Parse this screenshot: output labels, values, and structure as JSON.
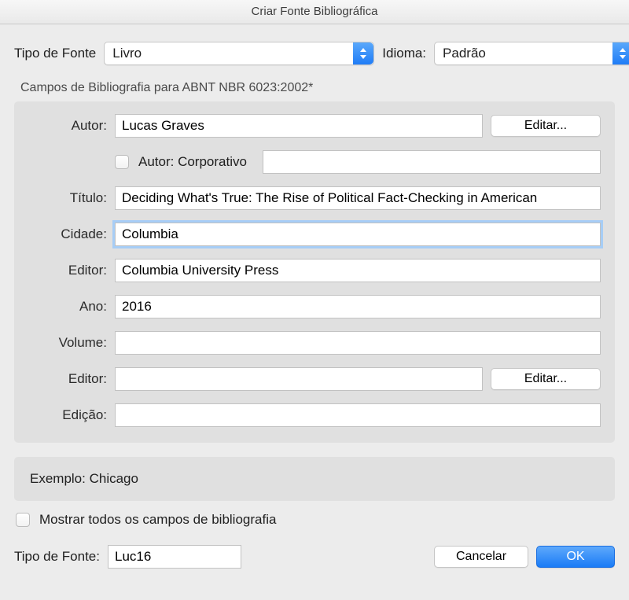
{
  "window": {
    "title": "Criar Fonte Bibliográfica"
  },
  "top": {
    "type_label": "Tipo de Fonte",
    "type_value": "Livro",
    "lang_label": "Idioma:",
    "lang_value": "Padrão"
  },
  "section_label": "Campos de Bibliografia para ABNT NBR 6023:2002*",
  "fields": {
    "author_label": "Autor:",
    "author_value": "Lucas Graves",
    "edit_button": "Editar...",
    "author_corp_label": "Autor: Corporativo",
    "author_corp_value": "",
    "title_label": "Título:",
    "title_value": "Deciding What's True: The Rise of Political Fact-Checking in American",
    "city_label": "Cidade:",
    "city_value": "Columbia",
    "publisher_label": "Editor:",
    "publisher_value": "Columbia University Press",
    "year_label": "Ano:",
    "year_value": "2016",
    "volume_label": "Volume:",
    "volume_value": "",
    "editor2_label": "Editor:",
    "editor2_value": "",
    "edition_label": "Edição:",
    "edition_value": ""
  },
  "example": {
    "text": "Exemplo: Chicago"
  },
  "show_all": {
    "label": "Mostrar todos os campos de bibliografia"
  },
  "footer": {
    "tag_label": "Tipo de Fonte:",
    "tag_value": "Luc16",
    "cancel": "Cancelar",
    "ok": "OK"
  }
}
